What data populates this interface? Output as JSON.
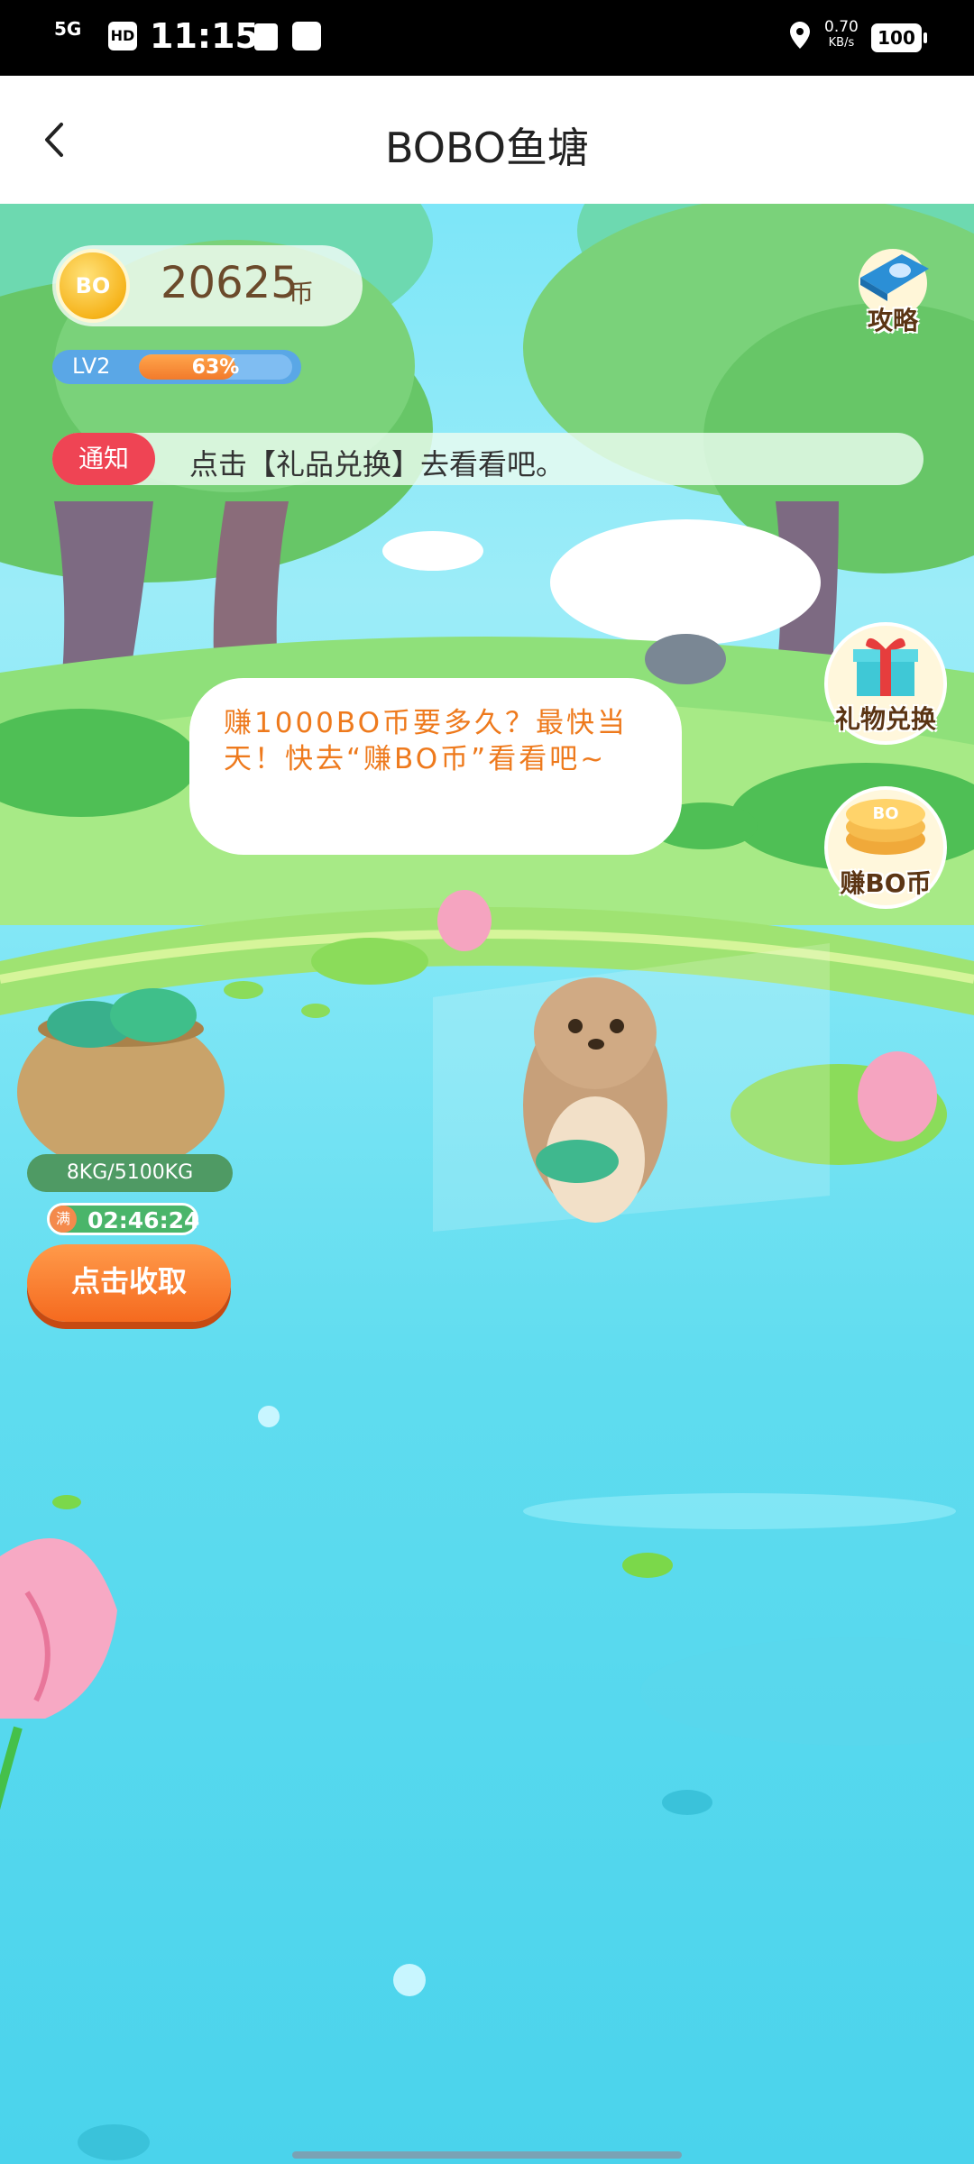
{
  "status_bar": {
    "network": "5G",
    "hd": "HD",
    "time": "11:15",
    "speed_value": "0.70",
    "speed_unit": "KB/s",
    "battery": "100"
  },
  "header": {
    "title": "BOBO鱼塘"
  },
  "coins": {
    "icon_text": "BO",
    "value": "20625",
    "unit": "币"
  },
  "level": {
    "label": "LV2",
    "percent_text": "63%",
    "progress": 0.63
  },
  "guide": {
    "label": "攻略"
  },
  "notice": {
    "tag": "通知",
    "text": "点击【礼品兑换】去看看吧。"
  },
  "bubble": {
    "text": "赚1000BO币要多久？最快当天！快去“赚BO币”看看吧~"
  },
  "side_buttons": {
    "gift_exchange": "礼物兑换",
    "earn_coins": "赚BO币",
    "earn_coins_icon_text": "BO"
  },
  "basket": {
    "capacity": "8KG/5100KG",
    "full_badge": "满",
    "timer": "02:46:24",
    "collect_label": "点击收取"
  },
  "colors": {
    "accent_orange": "#f56a1f",
    "notice_red": "#ef4454",
    "bubble_text": "#ee7a1d"
  }
}
